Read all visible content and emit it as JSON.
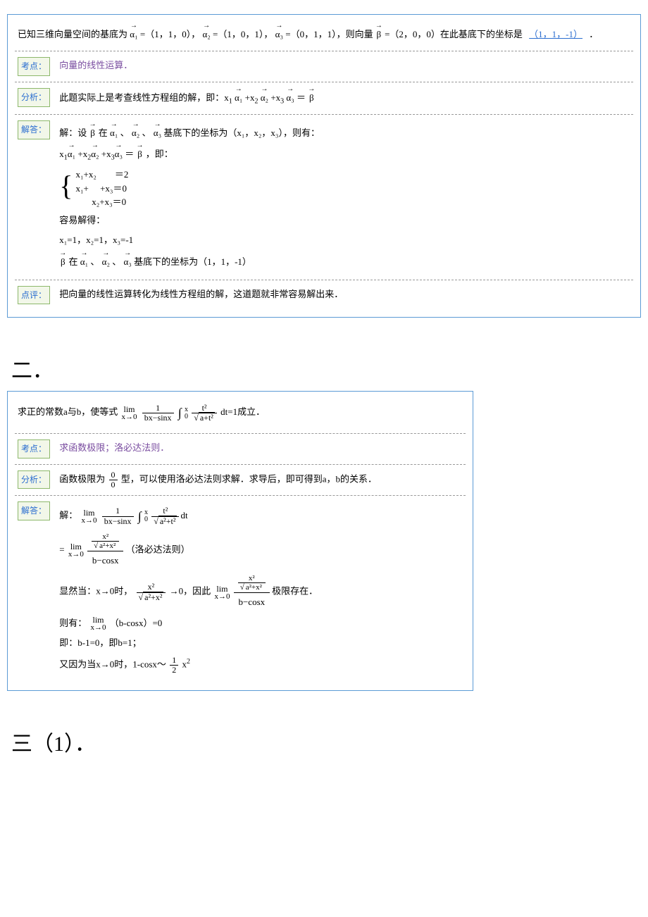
{
  "problem1": {
    "question": {
      "prefix": "已知三维向量空间的基底为",
      "a1_val": "=（1，1，0），",
      "a2_val": "=（1，0，1），",
      "a3_val": "=（0，1，1），则向量",
      "beta_val": "=（2，0，0）在此基底下的坐标是",
      "answer": "（1，1，-1）",
      "period": "．"
    },
    "kaodian": {
      "label": "考点：",
      "text": "向量的线性运算．"
    },
    "fenxi": {
      "label": "分析：",
      "text": "此题实际上是考查线性方程组的解，即：x",
      "eq_tail": "＝"
    },
    "jieda": {
      "label": "解答：",
      "l1a": "解：设",
      "l1b": "在",
      "l1c": "、",
      "l1d": "、",
      "l1e": "基底下的坐标为（x₁，x₂，x₃），则有：",
      "l2_tail": "，即：",
      "sys1": "x₁+x₂        ＝2",
      "sys2": "x₁+     +x₃＝0",
      "sys3": "       x₂+x₃＝0",
      "l3": "容易解得：",
      "l4": "x₁=1，x₂=1，x₃=-1",
      "l5a": "在",
      "l5b": "、",
      "l5c": "、",
      "l5d": "基底下的坐标为（1，1，-1）"
    },
    "dianping": {
      "label": "点评：",
      "text": "把向量的线性运算转化为线性方程组的解，这道题就非常容易解出来．"
    },
    "sym": {
      "a1": "α₁",
      "a2": "α₂",
      "a3": "α₃",
      "beta": "β",
      "arrow": "→"
    }
  },
  "heading2": "二．",
  "problem2": {
    "question": {
      "prefix": "求正的常数a与b，使等式",
      "suffix": "dt=1成立．"
    },
    "kaodian": {
      "label": "考点：",
      "text": "求函数极限；洛必达法则．"
    },
    "fenxi": {
      "label": "分析：",
      "t1": "函数极限为",
      "t2": "型，可以使用洛必达法则求解．求导后，即可得到a，b的关系．"
    },
    "jieda": {
      "label": "解答：",
      "l1": "解：",
      "lhop": "（洛必达法则）",
      "l3a": "显然当：x→0时，",
      "l3b": "→0，因此",
      "l3c": " 极限存在．",
      "l4a": "则有：",
      "l4b": "（b-cosx）=0",
      "l5": "即：b-1=0，即b=1；",
      "l6a": "又因为当x→0时，1-cosx～",
      "l6b": "x"
    },
    "math": {
      "lim": "lim",
      "xto0": "x→0",
      "one": "1",
      "bxmsinx": "bx−sinx",
      "int_sym": "∫",
      "int_up": "x",
      "int_lo": "0",
      "t2": "t²",
      "sqrt_at2": "a+t²",
      "sqrt_a2t2": "a²+t²",
      "x2": "x²",
      "sqrt_a2x2": "a²+x²",
      "bmcosx": "b−cosx",
      "zero": "0",
      "half": "1",
      "two": "2",
      "sq": "2"
    }
  },
  "heading3": "三（1）．"
}
